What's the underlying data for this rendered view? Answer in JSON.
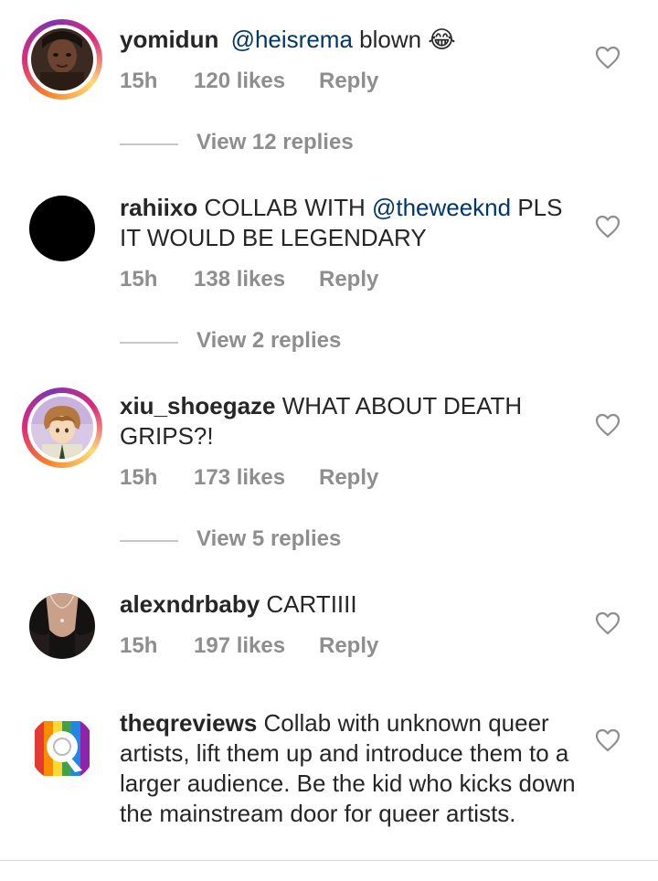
{
  "comments": [
    {
      "username": "yomidun",
      "mention": "@heisrema",
      "text": " blown 😂",
      "time": "15h",
      "likes": "120 likes",
      "reply": "Reply",
      "view_replies": "View 12 replies",
      "avatar": "photo-woman-icon"
    },
    {
      "username": "rahiixo",
      "text_before": " COLLAB WITH ",
      "mention": "@theweeknd",
      "text_after": " PLS IT WOULD BE LEGENDARY",
      "time": "15h",
      "likes": "138 likes",
      "reply": "Reply",
      "view_replies": "View 2 replies",
      "avatar": "black-circle-icon"
    },
    {
      "username": "xiu_shoegaze",
      "text": " WHAT ABOUT DEATH GRIPS?!",
      "time": "15h",
      "likes": "173 likes",
      "reply": "Reply",
      "view_replies": "View 5 replies",
      "avatar": "anime-character-icon"
    },
    {
      "username": "alexndrbaby",
      "text": " CARTIIII",
      "time": "15h",
      "likes": "197 likes",
      "reply": "Reply",
      "avatar": "photo-necklace-icon"
    },
    {
      "username": "theqreviews",
      "text": " Collab with unknown queer artists, lift them up and introduce them to a larger audience. Be the kid who kicks down the mainstream door for queer artists.",
      "avatar": "rainbow-q-logo-icon"
    }
  ],
  "colors": {
    "text": "#262626",
    "meta": "#8e8e8e",
    "mention": "#00376b"
  }
}
